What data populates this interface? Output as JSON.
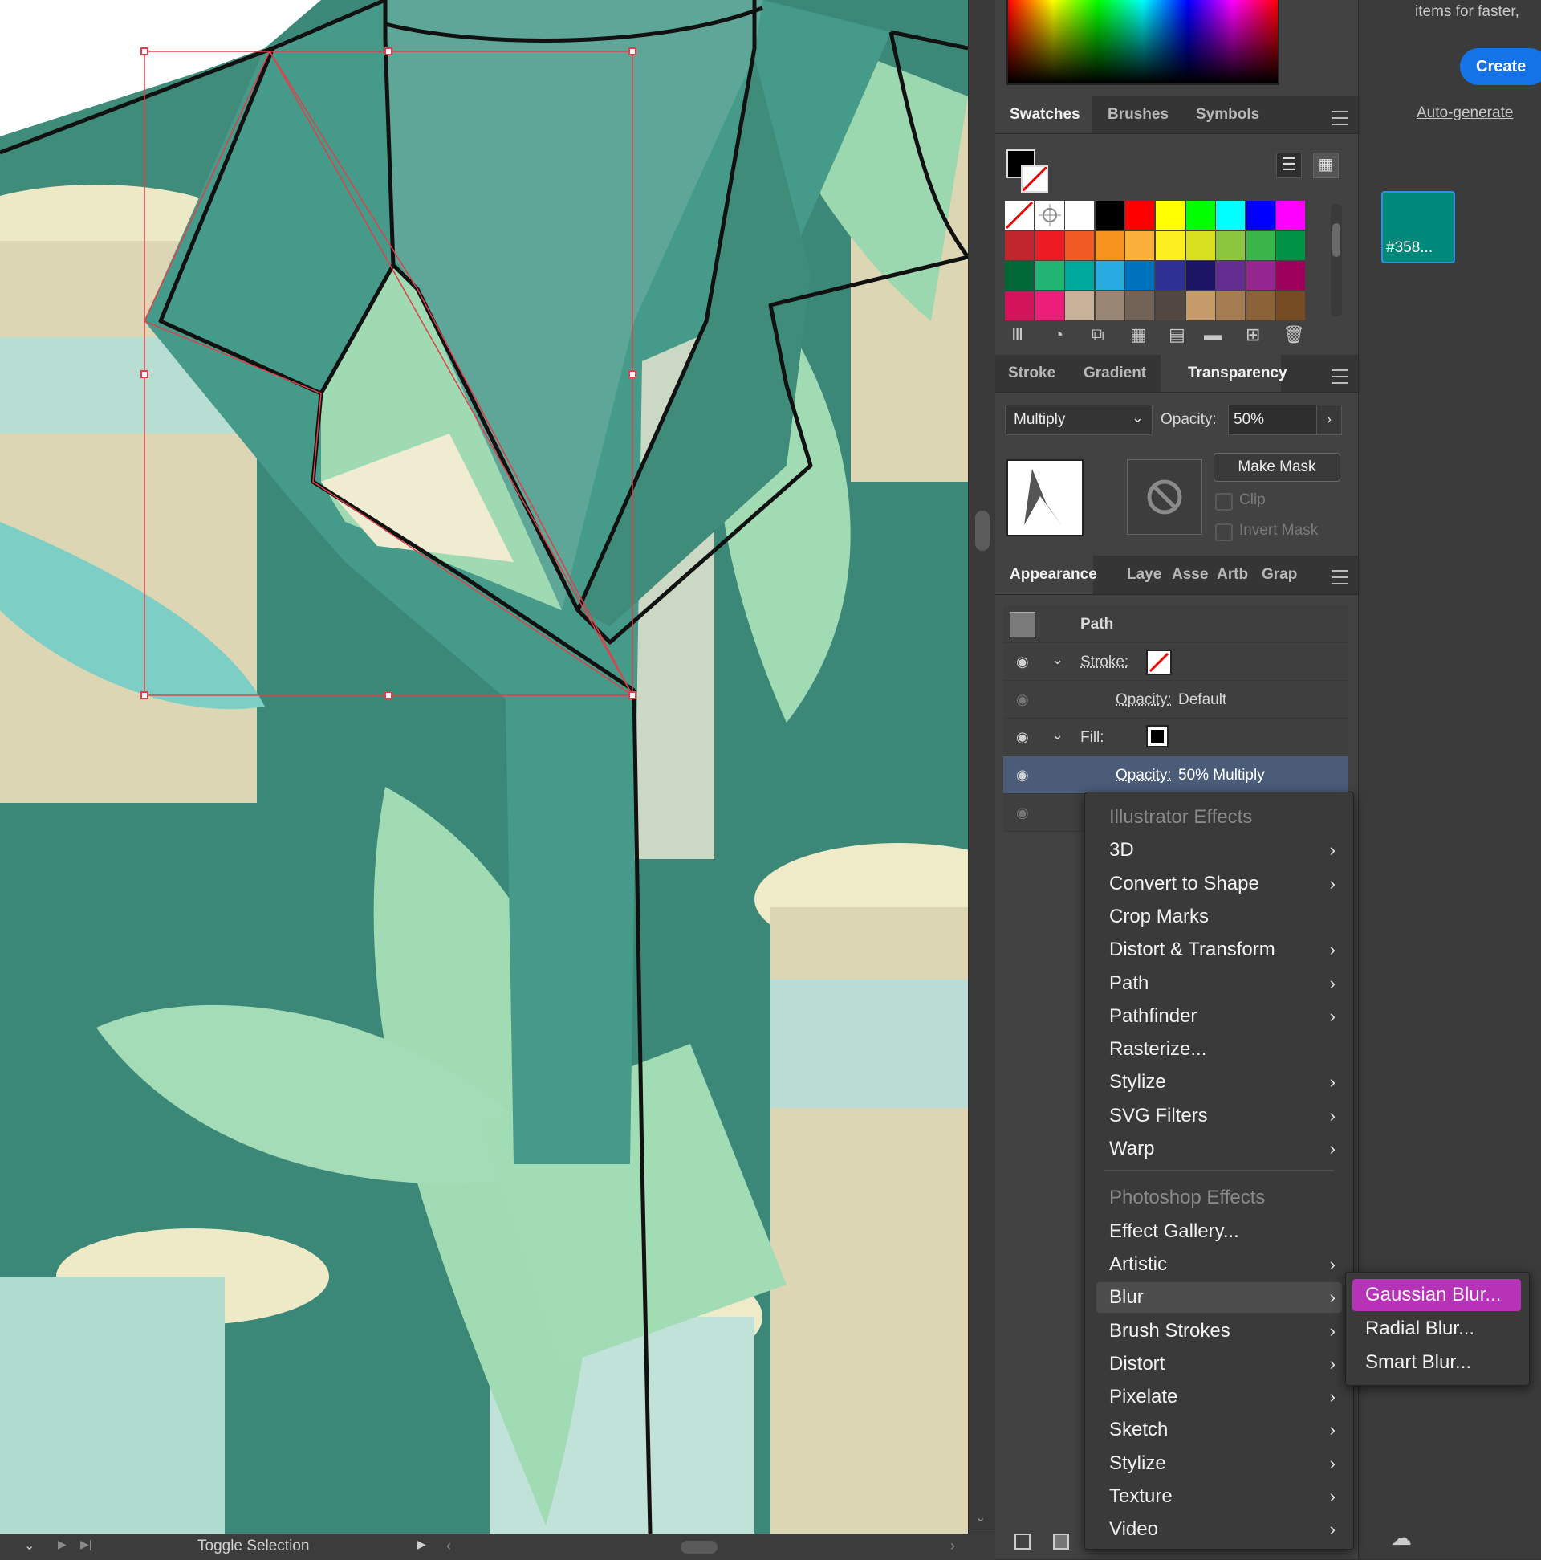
{
  "status_bar": {
    "toggle_label": "Toggle Selection"
  },
  "swatches_panel": {
    "tabs": [
      "Swatches",
      "Brushes",
      "Symbols"
    ],
    "swatch_rows": [
      [
        "#ffffff",
        "#ffffff",
        "#ffffff",
        "#000000",
        "#ff0000",
        "#ffff00",
        "#00ff00",
        "#00ffff",
        "#0000ff",
        "#ff00ff"
      ],
      [
        "#c1272d",
        "#ed1c24",
        "#f15a24",
        "#f7931e",
        "#fbb03b",
        "#fcee21",
        "#d9e021",
        "#8cc63f",
        "#39b54a",
        "#009245"
      ],
      [
        "#006837",
        "#22b573",
        "#00a99d",
        "#29abe2",
        "#0071bc",
        "#2e3192",
        "#1b1464",
        "#662d91",
        "#93278f",
        "#9e005d"
      ],
      [
        "#d4145a",
        "#ed1e79",
        "#c7b299",
        "#998675",
        "#736357",
        "#534741",
        "#c69c6d",
        "#a67c52",
        "#8c6239",
        "#754c24"
      ]
    ]
  },
  "transparency_panel": {
    "tabs": [
      "Stroke",
      "Gradient",
      "Transparency"
    ],
    "blend_mode": "Multiply",
    "opacity_label": "Opacity:",
    "opacity_value": "50%",
    "make_mask": "Make Mask",
    "clip": "Clip",
    "invert_mask": "Invert Mask"
  },
  "appearance_panel": {
    "tabs": [
      "Appearance",
      "Laye",
      "Asse",
      "Artb",
      "Grap"
    ],
    "rows": {
      "path": "Path",
      "stroke": "Stroke:",
      "stroke_opacity_label": "Opacity:",
      "stroke_opacity_value": "Default",
      "fill": "Fill:",
      "fill_opacity_label": "Opacity:",
      "fill_opacity_value": "50% Multiply"
    }
  },
  "effects_menu": {
    "illustrator_header": "Illustrator Effects",
    "illustrator_items": [
      {
        "label": "3D",
        "sub": true
      },
      {
        "label": "Convert to Shape",
        "sub": true
      },
      {
        "label": "Crop Marks",
        "sub": false
      },
      {
        "label": "Distort & Transform",
        "sub": true
      },
      {
        "label": "Path",
        "sub": true
      },
      {
        "label": "Pathfinder",
        "sub": true
      },
      {
        "label": "Rasterize...",
        "sub": false
      },
      {
        "label": "Stylize",
        "sub": true
      },
      {
        "label": "SVG Filters",
        "sub": true
      },
      {
        "label": "Warp",
        "sub": true
      }
    ],
    "photoshop_header": "Photoshop Effects",
    "photoshop_items": [
      {
        "label": "Effect Gallery...",
        "sub": false
      },
      {
        "label": "Artistic",
        "sub": true
      },
      {
        "label": "Blur",
        "sub": true,
        "highlighted": true
      },
      {
        "label": "Brush Strokes",
        "sub": true
      },
      {
        "label": "Distort",
        "sub": true
      },
      {
        "label": "Pixelate",
        "sub": true
      },
      {
        "label": "Sketch",
        "sub": true
      },
      {
        "label": "Stylize",
        "sub": true
      },
      {
        "label": "Texture",
        "sub": true
      },
      {
        "label": "Video",
        "sub": true
      }
    ]
  },
  "blur_submenu": {
    "items": [
      {
        "label": "Gaussian Blur...",
        "selected": true
      },
      {
        "label": "Radial Blur...",
        "selected": false
      },
      {
        "label": "Smart Blur...",
        "selected": false
      }
    ]
  },
  "right_panel": {
    "top_text": "items for faster,",
    "create_button": "Create",
    "autogen_link": "Auto-generate",
    "color_chip_label": "#358...",
    "color_chip_color": "#00897b"
  },
  "colors": {
    "selection_highlight": "#b632b6",
    "shirt_teal": "#3b8878",
    "leaf_green": "#a0dbb4",
    "create_blue": "#1473e6"
  }
}
